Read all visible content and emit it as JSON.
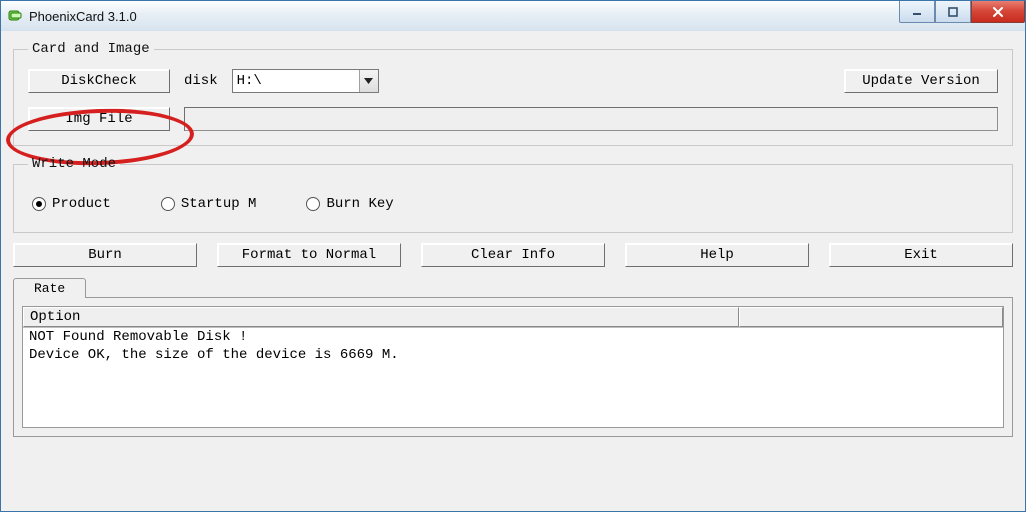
{
  "titlebar": {
    "title": "PhoenixCard 3.1.0"
  },
  "card_image": {
    "legend": "Card and Image",
    "diskcheck_label": "DiskCheck",
    "disk_label": "disk",
    "disk_value": "H:\\",
    "update_label": "Update Version",
    "imgfile_label": "Img File",
    "img_path": ""
  },
  "write_mode": {
    "legend": "Write Mode",
    "options": [
      {
        "label": "Product",
        "checked": true
      },
      {
        "label": "Startup M",
        "checked": false
      },
      {
        "label": "Burn Key",
        "checked": false
      }
    ]
  },
  "actions": {
    "burn": "Burn",
    "format": "Format to Normal",
    "clear": "Clear Info",
    "help": "Help",
    "exit": "Exit"
  },
  "tabs": {
    "rate": "Rate"
  },
  "list": {
    "header": "Option",
    "lines": "NOT Found Removable Disk !\nDevice OK, the size of the device is 6669 M."
  }
}
